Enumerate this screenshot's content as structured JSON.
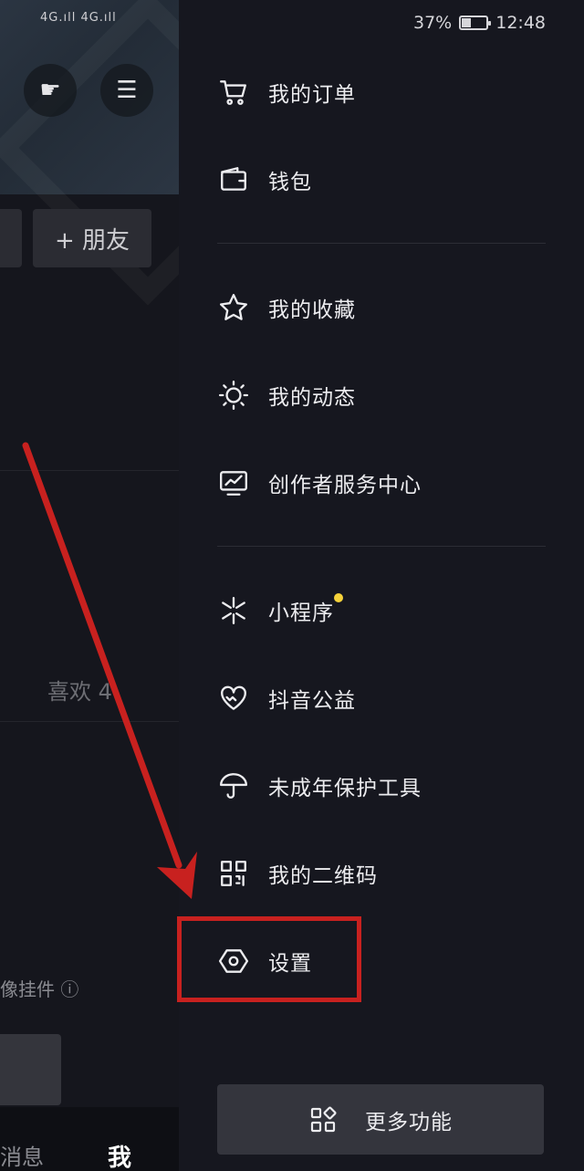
{
  "status_bar": {
    "signal": "4G.ıll 4G.ıll",
    "battery_percent": "37%",
    "battery_level": 0.37,
    "time": "12:48"
  },
  "background_profile": {
    "add_friend_label": "+ 朋友",
    "likes_tab": "喜欢 4",
    "widget_text": "像挂件 ⓘ",
    "tab_messages": "消息",
    "tab_me": "我"
  },
  "drawer": {
    "items": [
      {
        "label": "我的订单",
        "icon": "cart-icon"
      },
      {
        "label": "钱包",
        "icon": "wallet-icon"
      },
      {
        "label": "我的收藏",
        "icon": "star-icon"
      },
      {
        "label": "我的动态",
        "icon": "sun-icon"
      },
      {
        "label": "创作者服务中心",
        "icon": "chart-monitor-icon"
      },
      {
        "label": "小程序",
        "icon": "mini-program-icon"
      },
      {
        "label": "抖音公益",
        "icon": "charity-heart-icon"
      },
      {
        "label": "未成年保护工具",
        "icon": "umbrella-icon"
      },
      {
        "label": "我的二维码",
        "icon": "qr-code-icon"
      },
      {
        "label": "设置",
        "icon": "settings-hex-icon"
      }
    ],
    "more_label": "更多功能",
    "accent_dot_color": "#f6d23a"
  },
  "annotation": {
    "highlight_color": "#c8211f"
  }
}
